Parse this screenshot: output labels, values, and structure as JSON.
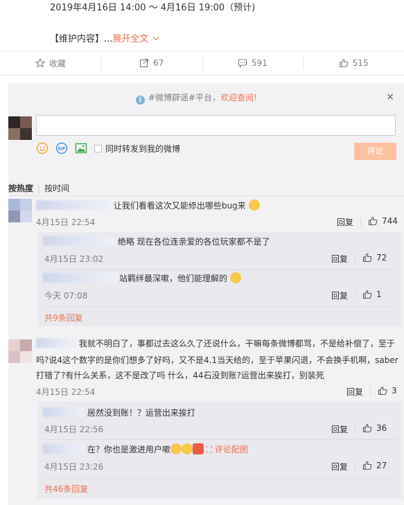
{
  "post": {
    "maintenance_time": "2019年4月16日 14:00 ～ 4月16日 19:00（预计)",
    "content_prefix": "【维护内容】...",
    "expand_label": "展开全文"
  },
  "actions": {
    "favorite": "收藏",
    "repost": "67",
    "comment": "591",
    "like": "515"
  },
  "notice": {
    "prefix": "#微博辟谣#平台，",
    "link": "欢迎查阅!",
    "close": "×"
  },
  "composer": {
    "input_value": "",
    "repost_option": "同时转发到我的微博",
    "submit_label": "评论"
  },
  "sort": {
    "hot": "按热度",
    "time": "按时间",
    "separator": "|"
  },
  "comments": [
    {
      "text": "让我们看看这次又能修出哪些bug来",
      "time": "4月15日 22:54",
      "reply": "回复",
      "likes": "744",
      "replies": [
        {
          "text": "绝略 现在各位连亲爱的各位玩家都不是了",
          "time": "4月15日 23:02",
          "reply": "回复",
          "likes": "72"
        },
        {
          "text": "站羁绊最深嗽，他们能理解的",
          "time": "今天 07:08",
          "reply": "回复",
          "likes": "1"
        }
      ],
      "more_replies": "共9条回复"
    },
    {
      "text_line1": "我就不明白了，事都过去这么久了还说什么，干嘛每条微博都骂，不是给补偿了，至于",
      "text_line2": "吗?说4这个数字的是你们想多了好吗，又不是4.1当天给的，至于苹果闪退，不会换手机啊，saber",
      "text_line3": "打错了?有什么关系，这不是改了吗 什么，44石没到账?运营出来挨打，别装死",
      "time": "4月15日 22:54",
      "reply": "回复",
      "likes": "3",
      "replies": [
        {
          "text": "居然没到账！？运营出来挨打",
          "time": "4月15日 22:56",
          "reply": "回复",
          "likes": "36"
        },
        {
          "text": "在？你也是激进用户嗽",
          "pic_link": "评论配图",
          "time": "4月15日 23:26",
          "reply": "回复",
          "likes": "27"
        }
      ],
      "more_replies": "共46条回复"
    }
  ],
  "colors": {
    "accent": "#eb7350",
    "panel_bg": "#f2f2f5",
    "subbox_bg": "#e9e9ee",
    "submit_bg": "#ffc09f"
  }
}
